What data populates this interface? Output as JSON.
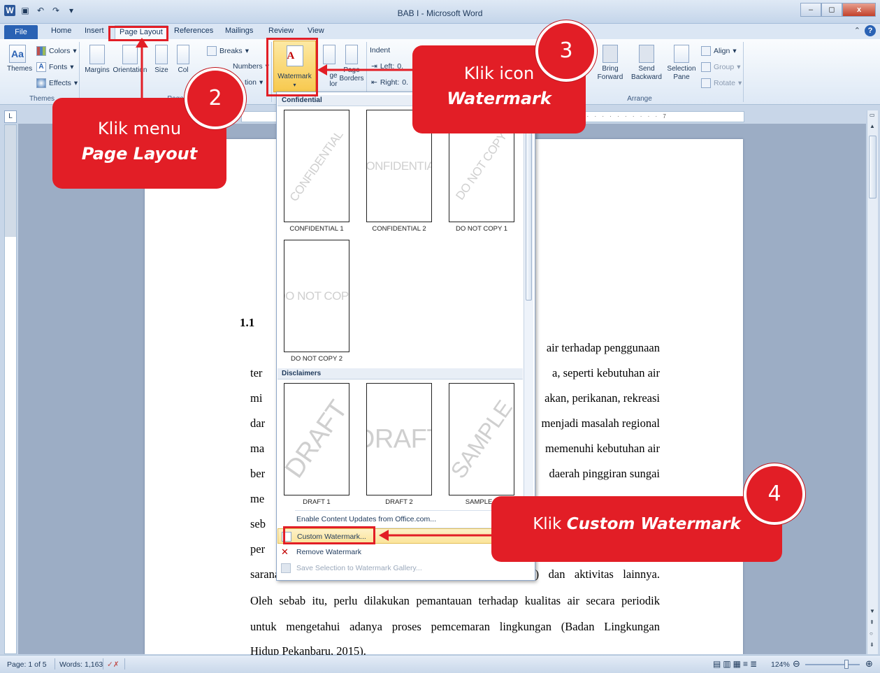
{
  "window": {
    "title": "BAB I - Microsoft Word",
    "minimize": "–",
    "maximize": "◻",
    "close": "x"
  },
  "tabs": {
    "file": "File",
    "home": "Home",
    "insert": "Insert",
    "page_layout": "Page Layout",
    "references": "References",
    "mailings": "Mailings",
    "review": "Review",
    "view": "View",
    "help": "?"
  },
  "ribbon": {
    "themes": "Themes",
    "colors": "Colors",
    "fonts": "Fonts",
    "effects": "Effects",
    "themes_group": "Themes",
    "margins": "Margins",
    "orientation": "Orientation",
    "size": "Size",
    "columns": "Col",
    "breaks": "Breaks",
    "line_numbers": "Numbers",
    "hyphenation": "tion",
    "page_setup_group": "Page Set",
    "watermark": "Watermark",
    "page_color": "Page\nColor",
    "page_color_a": "ge",
    "page_color_b": "lor",
    "page_borders_a": "Page",
    "page_borders_b": "Borders",
    "indent": "Indent",
    "indent_left_label": "Left:",
    "indent_left_value": "0.",
    "indent_right_label": "Right:",
    "indent_right_value": "0.",
    "bring_forward_a": "Bring",
    "bring_forward_b": "Forward",
    "send_backward_a": "Send",
    "send_backward_b": "Backward",
    "selection_pane_a": "Selection",
    "selection_pane_b": "Pane",
    "align": "Align",
    "group": "Group",
    "rotate": "Rotate",
    "arrange_group": "Arrange"
  },
  "ruler": {
    "h_ticks": "5 · · · · · · · · · · · 7"
  },
  "watermark_gallery": {
    "section_confidential": "Confidential",
    "section_disclaimers": "Disclaimers",
    "items": [
      {
        "label": "CONFIDENTIAL 1",
        "text": "CONFIDENTIAL"
      },
      {
        "label": "CONFIDENTIAL 2",
        "text": "CONFIDENTIAL"
      },
      {
        "label": "DO NOT COPY 1",
        "text": "DO NOT COPY"
      },
      {
        "label": "DO NOT COPY 2",
        "text": "DO NOT COPY"
      },
      {
        "label": "DRAFT 1",
        "text": "DRAFT"
      },
      {
        "label": "DRAFT 2",
        "text": "DRAFT"
      },
      {
        "label": "SAMPLE 1",
        "text": "SAMPLE"
      }
    ],
    "menu": {
      "enable_updates": "Enable Content Updates from Office.com...",
      "custom": "Custom Watermark...",
      "remove": "Remove Watermark",
      "save_selection": "Save Selection to Watermark Gallery..."
    }
  },
  "document": {
    "heading": "1.1",
    "lines": [
      {
        "left": "",
        "right": "air terhadap penggunaan"
      },
      {
        "left": "ter",
        "right": "a, seperti kebutuhan air"
      },
      {
        "left": "mi",
        "right": "akan, perikanan, rekreasi"
      },
      {
        "left": "dar",
        "right": "menjadi masalah regional"
      },
      {
        "left": "ma",
        "right": "memenuhi kebutuhan air"
      },
      {
        "left": "ber",
        "right": "daerah pinggiran sungai"
      },
      {
        "left": "me",
        "right": ""
      },
      {
        "left": "seb",
        "right": ""
      },
      {
        "left": "per",
        "right": ""
      }
    ],
    "full_lines": [
      "sarana transportasi, perikanan, mandi-cuci-kakus (MCK) dan aktivitas lainnya.",
      "Oleh sebab itu, perlu dilakukan pemantauan terhadap kualitas air secara periodik",
      "untuk mengetahui adanya proses pemcemaran lingkungan (Badan Lingkungan",
      "Hidup Pekanbaru, 2015)."
    ]
  },
  "status": {
    "page": "Page: 1 of 5",
    "words": "Words: 1,163",
    "zoom": "124%"
  },
  "annotations": {
    "step2_number": "2",
    "step2_line1": "Klik menu",
    "step2_line2": "Page Layout",
    "step3_number": "3",
    "step3_line1": "Klik icon",
    "step3_line2": "Watermark",
    "step4_number": "4",
    "step4_prefix": "Klik ",
    "step4_emph": "Custom  Watermark"
  },
  "colors": {
    "annotation_red": "#e21e26",
    "highlight_yellow": "#fbe49a",
    "word_blue": "#2a62b4"
  }
}
